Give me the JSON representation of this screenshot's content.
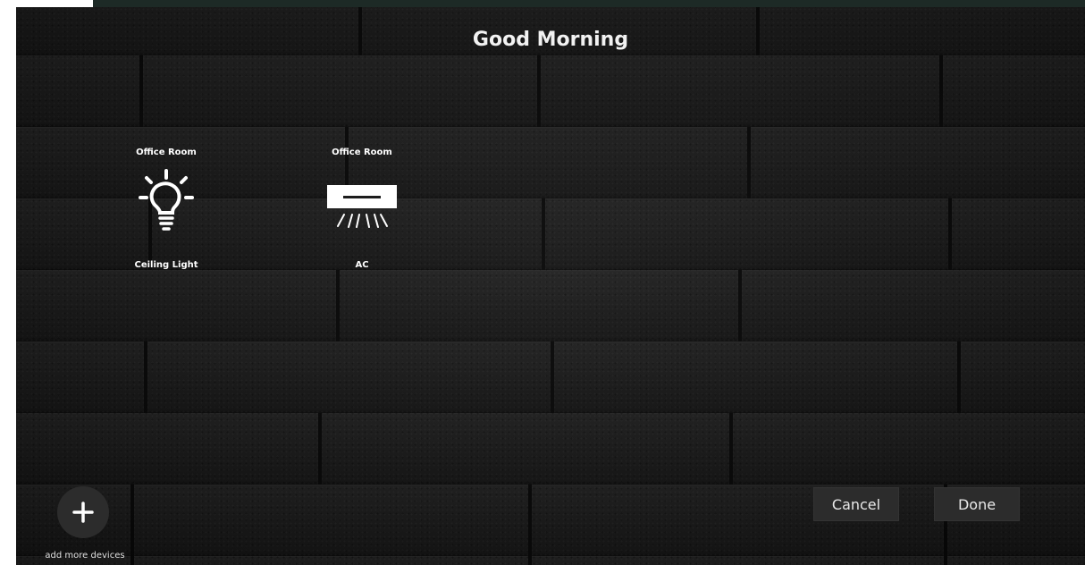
{
  "header": {
    "greeting": "Good Morning"
  },
  "devices": [
    {
      "room": "Office Room",
      "name": "Ceiling Light",
      "icon": "lightbulb-icon"
    },
    {
      "room": "Office Room",
      "name": "AC",
      "icon": "air-conditioner-icon"
    }
  ],
  "actions": {
    "add_label": "add more devices",
    "add_icon": "plus-icon",
    "cancel_label": "Cancel",
    "done_label": "Done"
  },
  "colors": {
    "text": "#ffffff",
    "button_bg": "#2c2c2c",
    "top_bar": "#1d2a26"
  }
}
